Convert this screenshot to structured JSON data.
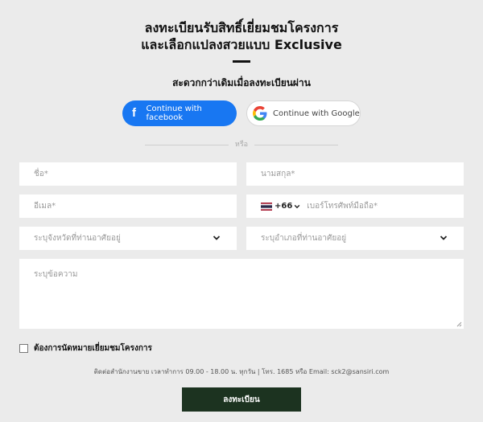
{
  "header": {
    "title_line1": "ลงทะเบียนรับสิทธิ์เยี่ยมชมโครงการ",
    "title_line2": "และเลือกแปลงสวยแบบ Exclusive",
    "subtitle": "สะดวกกว่าเดิมเมื่อลงทะเบียนผ่าน"
  },
  "social": {
    "facebook_label": "Continue with facebook",
    "google_label": "Continue with Google",
    "facebook_color": "#1877f2"
  },
  "divider": {
    "or_label": "หรือ"
  },
  "form": {
    "first_name_placeholder": "ชื่อ*",
    "last_name_placeholder": "นามสกุล*",
    "email_placeholder": "อีเมล*",
    "country_code": "+66",
    "phone_placeholder": "เบอร์โทรศัพท์มือถือ*",
    "province_placeholder": "ระบุจังหวัดที่ท่านอาศัยอยู่",
    "district_placeholder": "ระบุอำเภอที่ท่านอาศัยอยู่",
    "message_placeholder": "ระบุข้อความ",
    "visit_checkbox_label": "ต้องการนัดหมายเยี่ยมชมโครงการ",
    "contact_info": "ติดต่อสำนักงานขาย เวลาทำการ 09.00 - 18.00 น. ทุกวัน | โทร. 1685 หรือ Email: sck2@sansiri.com",
    "submit_label": "ลงทะเบียน",
    "submit_color": "#1c3320"
  },
  "icons": {
    "facebook": "facebook-f-icon",
    "google": "google-g-icon",
    "flag": "thailand-flag-icon",
    "chevron": "chevron-down-icon"
  }
}
